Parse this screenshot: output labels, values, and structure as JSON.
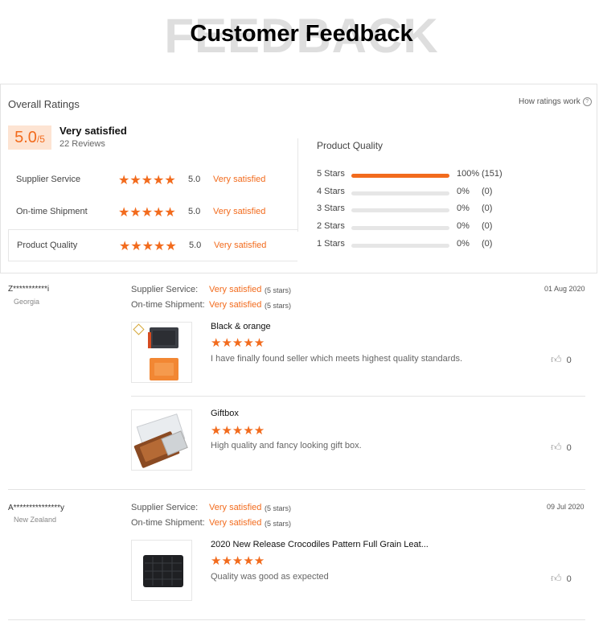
{
  "header": {
    "bg_word": "FEEDBACK",
    "title": "Customer Feedback"
  },
  "summary": {
    "overall_label": "Overall Ratings",
    "how_label": "How ratings work",
    "score": "5.0",
    "score_out_of": "/5",
    "satisfaction": "Very satisfied",
    "reviews": "22 Reviews",
    "categories": [
      {
        "label": "Supplier Service",
        "stars": "★★★★★",
        "score": "5.0",
        "text": "Very satisfied"
      },
      {
        "label": "On-time Shipment",
        "stars": "★★★★★",
        "score": "5.0",
        "text": "Very satisfied"
      },
      {
        "label": "Product Quality",
        "stars": "★★★★★",
        "score": "5.0",
        "text": "Very satisfied"
      }
    ]
  },
  "product_quality": {
    "title": "Product Quality",
    "rows": [
      {
        "label": "5 Stars",
        "fraction": 1.0,
        "percent": "100%",
        "count": "(151)"
      },
      {
        "label": "4 Stars",
        "fraction": 0,
        "percent": "0%",
        "count": "(0)"
      },
      {
        "label": "3 Stars",
        "fraction": 0,
        "percent": "0%",
        "count": "(0)"
      },
      {
        "label": "2 Stars",
        "fraction": 0,
        "percent": "0%",
        "count": "(0)"
      },
      {
        "label": "1 Stars",
        "fraction": 0,
        "percent": "0%",
        "count": "(0)"
      }
    ]
  },
  "reviews": [
    {
      "name": "Z***********i",
      "country": "Georgia",
      "date": "01 Aug 2020",
      "supplier_label": "Supplier Service:",
      "supplier_value": "Very satisfied",
      "supplier_sub": "(5 stars)",
      "shipment_label": "On-time Shipment:",
      "shipment_value": "Very satisfied",
      "shipment_sub": "(5 stars)",
      "items": [
        {
          "name": "Black & orange",
          "stars": "★★★★★",
          "text": "I have finally found seller which meets highest quality standards.",
          "likes": "0"
        },
        {
          "name": "Giftbox",
          "stars": "★★★★★",
          "text": "High quality and fancy looking gift box.",
          "likes": "0"
        }
      ]
    },
    {
      "name": "A***************y",
      "country": "New Zealand",
      "date": "09 Jul 2020",
      "supplier_label": "Supplier Service:",
      "supplier_value": "Very satisfied",
      "supplier_sub": "(5 stars)",
      "shipment_label": "On-time Shipment:",
      "shipment_value": "Very satisfied",
      "shipment_sub": "(5 stars)",
      "items": [
        {
          "name": "2020 New Release Crocodiles Pattern Full Grain Leat...",
          "stars": "★★★★★",
          "text": "Quality was good as expected",
          "likes": "0"
        }
      ]
    }
  ],
  "colors": {
    "accent": "#f26b1d",
    "score_bg": "#fde4d3",
    "track": "#e6e6e6"
  },
  "icons": [
    "question-circle-icon",
    "star-icon",
    "thumbs-up-icon"
  ]
}
